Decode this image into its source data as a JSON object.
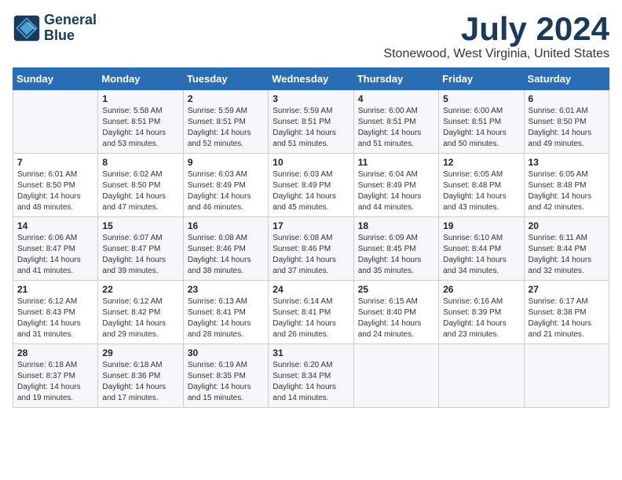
{
  "logo": {
    "line1": "General",
    "line2": "Blue"
  },
  "title": "July 2024",
  "location": "Stonewood, West Virginia, United States",
  "weekdays": [
    "Sunday",
    "Monday",
    "Tuesday",
    "Wednesday",
    "Thursday",
    "Friday",
    "Saturday"
  ],
  "weeks": [
    [
      {
        "day": "",
        "sunrise": "",
        "sunset": "",
        "daylight": ""
      },
      {
        "day": "1",
        "sunrise": "Sunrise: 5:58 AM",
        "sunset": "Sunset: 8:51 PM",
        "daylight": "Daylight: 14 hours and 53 minutes."
      },
      {
        "day": "2",
        "sunrise": "Sunrise: 5:59 AM",
        "sunset": "Sunset: 8:51 PM",
        "daylight": "Daylight: 14 hours and 52 minutes."
      },
      {
        "day": "3",
        "sunrise": "Sunrise: 5:59 AM",
        "sunset": "Sunset: 8:51 PM",
        "daylight": "Daylight: 14 hours and 51 minutes."
      },
      {
        "day": "4",
        "sunrise": "Sunrise: 6:00 AM",
        "sunset": "Sunset: 8:51 PM",
        "daylight": "Daylight: 14 hours and 51 minutes."
      },
      {
        "day": "5",
        "sunrise": "Sunrise: 6:00 AM",
        "sunset": "Sunset: 8:51 PM",
        "daylight": "Daylight: 14 hours and 50 minutes."
      },
      {
        "day": "6",
        "sunrise": "Sunrise: 6:01 AM",
        "sunset": "Sunset: 8:50 PM",
        "daylight": "Daylight: 14 hours and 49 minutes."
      }
    ],
    [
      {
        "day": "7",
        "sunrise": "Sunrise: 6:01 AM",
        "sunset": "Sunset: 8:50 PM",
        "daylight": "Daylight: 14 hours and 48 minutes."
      },
      {
        "day": "8",
        "sunrise": "Sunrise: 6:02 AM",
        "sunset": "Sunset: 8:50 PM",
        "daylight": "Daylight: 14 hours and 47 minutes."
      },
      {
        "day": "9",
        "sunrise": "Sunrise: 6:03 AM",
        "sunset": "Sunset: 8:49 PM",
        "daylight": "Daylight: 14 hours and 46 minutes."
      },
      {
        "day": "10",
        "sunrise": "Sunrise: 6:03 AM",
        "sunset": "Sunset: 8:49 PM",
        "daylight": "Daylight: 14 hours and 45 minutes."
      },
      {
        "day": "11",
        "sunrise": "Sunrise: 6:04 AM",
        "sunset": "Sunset: 8:49 PM",
        "daylight": "Daylight: 14 hours and 44 minutes."
      },
      {
        "day": "12",
        "sunrise": "Sunrise: 6:05 AM",
        "sunset": "Sunset: 8:48 PM",
        "daylight": "Daylight: 14 hours and 43 minutes."
      },
      {
        "day": "13",
        "sunrise": "Sunrise: 6:05 AM",
        "sunset": "Sunset: 8:48 PM",
        "daylight": "Daylight: 14 hours and 42 minutes."
      }
    ],
    [
      {
        "day": "14",
        "sunrise": "Sunrise: 6:06 AM",
        "sunset": "Sunset: 8:47 PM",
        "daylight": "Daylight: 14 hours and 41 minutes."
      },
      {
        "day": "15",
        "sunrise": "Sunrise: 6:07 AM",
        "sunset": "Sunset: 8:47 PM",
        "daylight": "Daylight: 14 hours and 39 minutes."
      },
      {
        "day": "16",
        "sunrise": "Sunrise: 6:08 AM",
        "sunset": "Sunset: 8:46 PM",
        "daylight": "Daylight: 14 hours and 38 minutes."
      },
      {
        "day": "17",
        "sunrise": "Sunrise: 6:08 AM",
        "sunset": "Sunset: 8:46 PM",
        "daylight": "Daylight: 14 hours and 37 minutes."
      },
      {
        "day": "18",
        "sunrise": "Sunrise: 6:09 AM",
        "sunset": "Sunset: 8:45 PM",
        "daylight": "Daylight: 14 hours and 35 minutes."
      },
      {
        "day": "19",
        "sunrise": "Sunrise: 6:10 AM",
        "sunset": "Sunset: 8:44 PM",
        "daylight": "Daylight: 14 hours and 34 minutes."
      },
      {
        "day": "20",
        "sunrise": "Sunrise: 6:11 AM",
        "sunset": "Sunset: 8:44 PM",
        "daylight": "Daylight: 14 hours and 32 minutes."
      }
    ],
    [
      {
        "day": "21",
        "sunrise": "Sunrise: 6:12 AM",
        "sunset": "Sunset: 8:43 PM",
        "daylight": "Daylight: 14 hours and 31 minutes."
      },
      {
        "day": "22",
        "sunrise": "Sunrise: 6:12 AM",
        "sunset": "Sunset: 8:42 PM",
        "daylight": "Daylight: 14 hours and 29 minutes."
      },
      {
        "day": "23",
        "sunrise": "Sunrise: 6:13 AM",
        "sunset": "Sunset: 8:41 PM",
        "daylight": "Daylight: 14 hours and 28 minutes."
      },
      {
        "day": "24",
        "sunrise": "Sunrise: 6:14 AM",
        "sunset": "Sunset: 8:41 PM",
        "daylight": "Daylight: 14 hours and 26 minutes."
      },
      {
        "day": "25",
        "sunrise": "Sunrise: 6:15 AM",
        "sunset": "Sunset: 8:40 PM",
        "daylight": "Daylight: 14 hours and 24 minutes."
      },
      {
        "day": "26",
        "sunrise": "Sunrise: 6:16 AM",
        "sunset": "Sunset: 8:39 PM",
        "daylight": "Daylight: 14 hours and 23 minutes."
      },
      {
        "day": "27",
        "sunrise": "Sunrise: 6:17 AM",
        "sunset": "Sunset: 8:38 PM",
        "daylight": "Daylight: 14 hours and 21 minutes."
      }
    ],
    [
      {
        "day": "28",
        "sunrise": "Sunrise: 6:18 AM",
        "sunset": "Sunset: 8:37 PM",
        "daylight": "Daylight: 14 hours and 19 minutes."
      },
      {
        "day": "29",
        "sunrise": "Sunrise: 6:18 AM",
        "sunset": "Sunset: 8:36 PM",
        "daylight": "Daylight: 14 hours and 17 minutes."
      },
      {
        "day": "30",
        "sunrise": "Sunrise: 6:19 AM",
        "sunset": "Sunset: 8:35 PM",
        "daylight": "Daylight: 14 hours and 15 minutes."
      },
      {
        "day": "31",
        "sunrise": "Sunrise: 6:20 AM",
        "sunset": "Sunset: 8:34 PM",
        "daylight": "Daylight: 14 hours and 14 minutes."
      },
      {
        "day": "",
        "sunrise": "",
        "sunset": "",
        "daylight": ""
      },
      {
        "day": "",
        "sunrise": "",
        "sunset": "",
        "daylight": ""
      },
      {
        "day": "",
        "sunrise": "",
        "sunset": "",
        "daylight": ""
      }
    ]
  ]
}
